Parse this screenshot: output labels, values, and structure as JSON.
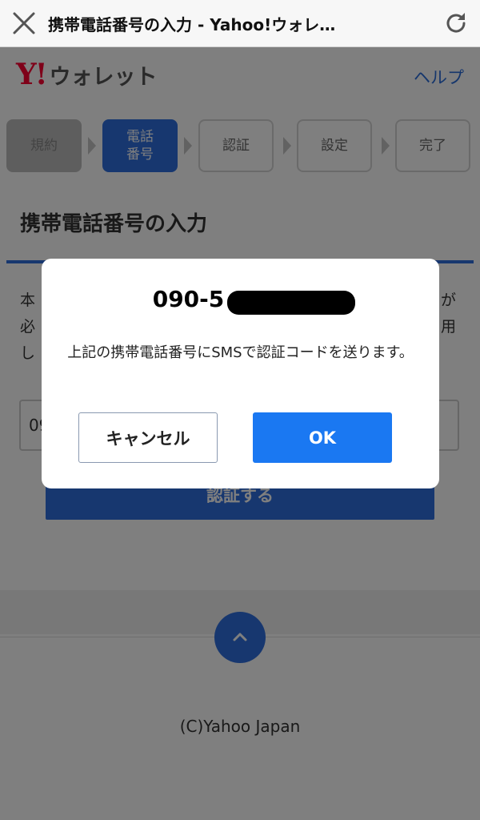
{
  "browser": {
    "title": "携帯電話番号の入力 - Yahoo!ウォレ…",
    "close_icon": "close-icon",
    "reload_icon": "reload-icon"
  },
  "header": {
    "logo_mark": "Y!",
    "logo_text": "ウォレット",
    "help_link": "ヘルプ"
  },
  "steps": [
    {
      "label": "規約",
      "state": "done"
    },
    {
      "label": "電話\n番号",
      "state": "current"
    },
    {
      "label": "認証",
      "state": "pending"
    },
    {
      "label": "設定",
      "state": "pending"
    },
    {
      "label": "完了",
      "state": "pending"
    }
  ],
  "section": {
    "title": "携帯電話番号の入力",
    "desc_line1": "本",
    "desc_line1_end": "が",
    "desc_line2": "必",
    "desc_line2_end": "用",
    "desc_line3": "し",
    "phone_value": "09",
    "verify_button": "認証する"
  },
  "footer": {
    "copyright": "(C)Yahoo Japan"
  },
  "dialog": {
    "phone_visible": "090-5",
    "message": "上記の携帯電話番号にSMSで認証コードを送ります。",
    "cancel_label": "キャンセル",
    "ok_label": "OK"
  },
  "colors": {
    "brand_red": "#ff0033",
    "accent_blue": "#2f6fde",
    "ok_blue": "#1a78f2"
  }
}
